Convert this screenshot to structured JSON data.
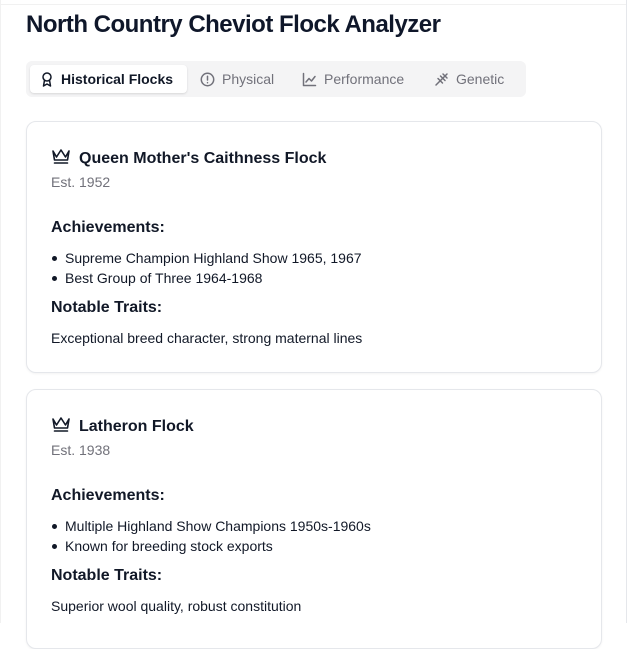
{
  "app": {
    "title": "North Country Cheviot Flock Analyzer"
  },
  "tabs": [
    {
      "label": "Historical Flocks",
      "icon": "award-icon",
      "active": true
    },
    {
      "label": "Physical",
      "icon": "alert-circle-icon",
      "active": false
    },
    {
      "label": "Performance",
      "icon": "line-chart-icon",
      "active": false
    },
    {
      "label": "Genetic",
      "icon": "dna-icon",
      "active": false
    }
  ],
  "flocks": [
    {
      "name": "Queen Mother's Caithness Flock",
      "icon": "crown-icon",
      "established": "Est. 1952",
      "achievements_label": "Achievements:",
      "achievements": [
        "Supreme Champion Highland Show 1965, 1967",
        "Best Group of Three 1964-1968"
      ],
      "traits_label": "Notable Traits:",
      "traits": "Exceptional breed character, strong maternal lines"
    },
    {
      "name": "Latheron Flock",
      "icon": "crown-icon",
      "established": "Est. 1938",
      "achievements_label": "Achievements:",
      "achievements": [
        "Multiple Highland Show Champions 1950s-1960s",
        "Known for breeding stock exports"
      ],
      "traits_label": "Notable Traits:",
      "traits": "Superior wool quality, robust constitution"
    }
  ],
  "colors": {
    "text": "#111827",
    "muted": "#71717a",
    "tab_bg": "#f4f4f5",
    "border": "#e5e7eb"
  }
}
